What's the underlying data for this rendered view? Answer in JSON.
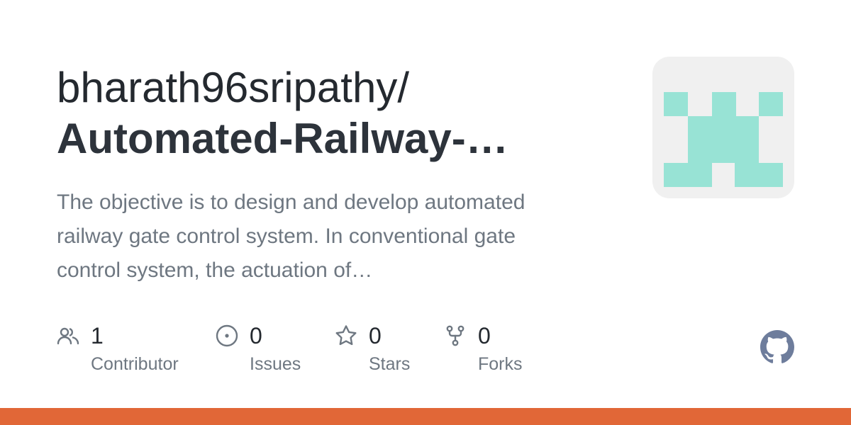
{
  "repo": {
    "owner": "bharath96sripathy/",
    "name": "Automated-Railway-…",
    "description_lines": [
      "The objective is to design and develop automated",
      "railway gate control system. In conventional gate",
      "control system, the actuation of…"
    ]
  },
  "stats": [
    {
      "icon": "people-icon",
      "count": "1",
      "label": "Contributor"
    },
    {
      "icon": "issue-icon",
      "count": "0",
      "label": "Issues"
    },
    {
      "icon": "star-icon",
      "count": "0",
      "label": "Stars"
    },
    {
      "icon": "fork-icon",
      "count": "0",
      "label": "Forks"
    }
  ],
  "colors": {
    "language_bar": "#e16737",
    "avatar_bg": "#f0f0f0",
    "avatar_fg": "#98e3d5",
    "icon": "#6e7781",
    "github_logo": "#6e7d9c"
  },
  "icons": {
    "avatar": "identicon",
    "brand": "github-logo-icon"
  }
}
